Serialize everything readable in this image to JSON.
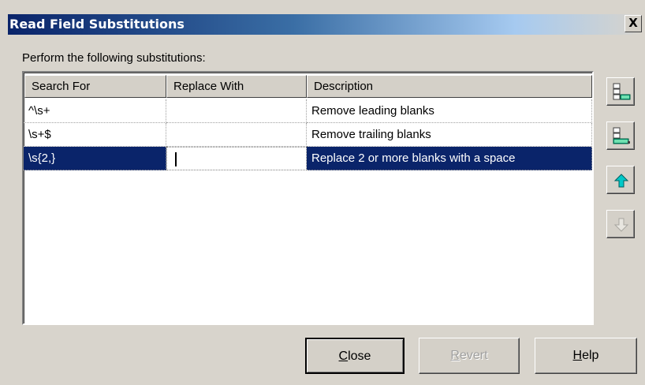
{
  "window": {
    "title": "Read Field Substitutions",
    "close_glyph": "X"
  },
  "prompt": "Perform the following substitutions:",
  "grid": {
    "columns": [
      "Search For",
      "Replace With",
      "Description"
    ],
    "rows": [
      {
        "search": "^\\s+",
        "replace": "",
        "description": "Remove leading blanks"
      },
      {
        "search": "\\s+$",
        "replace": "",
        "description": "Remove trailing blanks"
      },
      {
        "search": "\\s{2,}",
        "replace": "",
        "description": "Replace 2 or more blanks with a space"
      }
    ],
    "selected_row": 3,
    "editing_cell": "Replace With"
  },
  "side_buttons": {
    "insert_icon": "insert-row-icon",
    "delete_icon": "delete-row-icon",
    "move_up_icon": "move-up-arrow-icon",
    "move_down_icon": "move-down-arrow-icon",
    "move_down_disabled": true
  },
  "buttons": {
    "close_label": "Close",
    "close_mnemonic": "C",
    "close_rest": "lose",
    "revert_label": "Revert",
    "revert_mnemonic": "R",
    "revert_rest": "evert",
    "revert_disabled": true,
    "help_label": "Help",
    "help_mnemonic": "H",
    "help_rest": "elp"
  },
  "colors": {
    "title_gradient_start": "#0a246a",
    "title_gradient_end": "#a6caf0",
    "selection": "#0a246a",
    "face": "#d4d0c8",
    "arrow_green": "#00a080",
    "arrow_cyan": "#00c8c8"
  }
}
